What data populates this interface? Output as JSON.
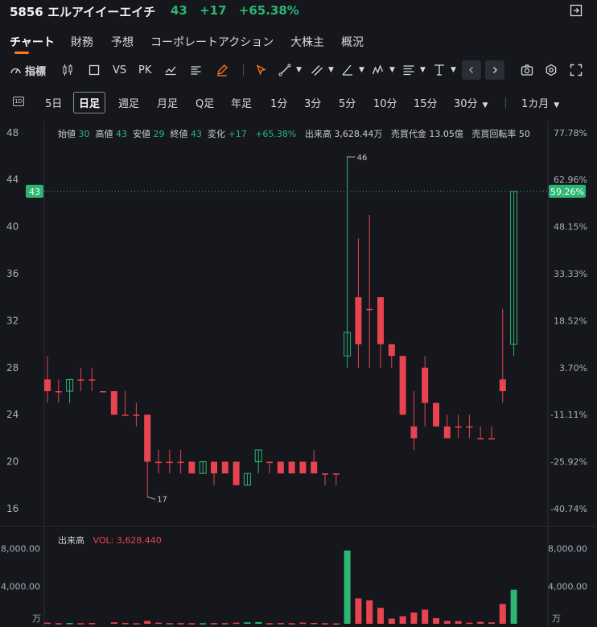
{
  "header": {
    "code_name": "5856 エルアイイーエイチ",
    "price": "43",
    "change": "+17",
    "change_pct": "+65.38%"
  },
  "tabs": [
    {
      "label": "チャート",
      "active": true
    },
    {
      "label": "財務"
    },
    {
      "label": "予想"
    },
    {
      "label": "コーポレートアクション"
    },
    {
      "label": "大株主"
    },
    {
      "label": "概況"
    }
  ],
  "toolbar": {
    "indicator_label": "指標",
    "vs_label": "VS",
    "pk_label": "PK"
  },
  "periods": {
    "icon_label": "1D",
    "items": [
      "5日",
      "日足",
      "週足",
      "月足",
      "Q足",
      "年足",
      "1分",
      "3分",
      "5分",
      "10分",
      "15分",
      "30分"
    ],
    "active": "日足",
    "range_label": "1カ月"
  },
  "ohlc": {
    "open_label": "始値",
    "open": "30",
    "high_label": "高値",
    "high": "43",
    "low_label": "安値",
    "low": "29",
    "close_label": "終値",
    "close": "43",
    "change_label": "変化",
    "change": "+17",
    "change_pct": "+65.38%",
    "volume_label": "出来高",
    "volume": "3,628.44万",
    "turnover_label": "売買代金",
    "turnover": "13.05億",
    "turnover_rate_label": "売買回転率",
    "turnover_rate": "50"
  },
  "volume_legend": {
    "title": "出来高",
    "vol_label": "VOL: 3,628.440"
  },
  "colors": {
    "up": "#2bb673",
    "down": "#e8444f",
    "accent": "#ff7a1a",
    "background": "#15171c"
  },
  "chart_data": {
    "type": "candlestick",
    "y_ticks": [
      48,
      44,
      40,
      36,
      32,
      28,
      24,
      20,
      16
    ],
    "y_pct_ticks": [
      "77.78%",
      "62.96%",
      "48.15%",
      "33.33%",
      "18.52%",
      "3.70%",
      "-11.11%",
      "-25.92%",
      "-40.74%"
    ],
    "ylim": [
      15,
      49
    ],
    "base_price": 27,
    "last_price": 43,
    "last_price_label": "43",
    "last_pct_label": "59.26%",
    "max_label": "46",
    "min_label": "17",
    "volume_ticks": [
      "8,000.00",
      "4,000.00"
    ],
    "volume_unit": "万",
    "volume_max": 9000,
    "candles": [
      {
        "o": 27,
        "h": 29,
        "l": 25,
        "c": 26,
        "v": 120
      },
      {
        "o": 26,
        "h": 27,
        "l": 25,
        "c": 26,
        "v": 60
      },
      {
        "o": 26,
        "h": 27,
        "l": 25,
        "c": 27,
        "v": 80
      },
      {
        "o": 27,
        "h": 28,
        "l": 26,
        "c": 27,
        "v": 60
      },
      {
        "o": 27,
        "h": 28,
        "l": 26,
        "c": 27,
        "v": 80
      },
      {
        "o": 26,
        "h": 26,
        "l": 26,
        "c": 26,
        "v": 0
      },
      {
        "o": 26,
        "h": 26,
        "l": 24,
        "c": 24,
        "v": 160
      },
      {
        "o": 24,
        "h": 26,
        "l": 24,
        "c": 24,
        "v": 90
      },
      {
        "o": 24,
        "h": 25,
        "l": 23,
        "c": 24,
        "v": 60
      },
      {
        "o": 24,
        "h": 24,
        "l": 17,
        "c": 20,
        "v": 300
      },
      {
        "o": 20,
        "h": 21,
        "l": 19,
        "c": 20,
        "v": 120
      },
      {
        "o": 20,
        "h": 21,
        "l": 19,
        "c": 20,
        "v": 70
      },
      {
        "o": 20,
        "h": 21,
        "l": 19,
        "c": 20,
        "v": 70
      },
      {
        "o": 20,
        "h": 20,
        "l": 19,
        "c": 19,
        "v": 60
      },
      {
        "o": 19,
        "h": 20,
        "l": 19,
        "c": 20,
        "v": 60
      },
      {
        "o": 20,
        "h": 20,
        "l": 18,
        "c": 19,
        "v": 70
      },
      {
        "o": 20,
        "h": 20,
        "l": 19,
        "c": 19,
        "v": 70
      },
      {
        "o": 20,
        "h": 20,
        "l": 18,
        "c": 18,
        "v": 120
      },
      {
        "o": 18,
        "h": 19,
        "l": 18,
        "c": 19,
        "v": 150
      },
      {
        "o": 20,
        "h": 21,
        "l": 19,
        "c": 21,
        "v": 180
      },
      {
        "o": 20,
        "h": 20,
        "l": 19,
        "c": 20,
        "v": 60
      },
      {
        "o": 20,
        "h": 20,
        "l": 19,
        "c": 19,
        "v": 80
      },
      {
        "o": 20,
        "h": 20,
        "l": 19,
        "c": 19,
        "v": 60
      },
      {
        "o": 20,
        "h": 20,
        "l": 19,
        "c": 19,
        "v": 120
      },
      {
        "o": 20,
        "h": 21,
        "l": 19,
        "c": 19,
        "v": 90
      },
      {
        "o": 19,
        "h": 19,
        "l": 18,
        "c": 19,
        "v": 60
      },
      {
        "o": 19,
        "h": 19,
        "l": 18,
        "c": 19,
        "v": 40
      },
      {
        "o": 29,
        "h": 46,
        "l": 28,
        "c": 31,
        "v": 7800
      },
      {
        "o": 34,
        "h": 39,
        "l": 28,
        "c": 30,
        "v": 2700
      },
      {
        "o": 33,
        "h": 41,
        "l": 28,
        "c": 33,
        "v": 2500
      },
      {
        "o": 34,
        "h": 34,
        "l": 28,
        "c": 30,
        "v": 1700
      },
      {
        "o": 30,
        "h": 30,
        "l": 28,
        "c": 29,
        "v": 550
      },
      {
        "o": 29,
        "h": 29,
        "l": 24,
        "c": 24,
        "v": 800
      },
      {
        "o": 23,
        "h": 26,
        "l": 21,
        "c": 22,
        "v": 1200
      },
      {
        "o": 28,
        "h": 29,
        "l": 23,
        "c": 25,
        "v": 1500
      },
      {
        "o": 25,
        "h": 25,
        "l": 23,
        "c": 23,
        "v": 600
      },
      {
        "o": 23,
        "h": 24,
        "l": 22,
        "c": 22,
        "v": 300
      },
      {
        "o": 23,
        "h": 24,
        "l": 22,
        "c": 23,
        "v": 280
      },
      {
        "o": 23,
        "h": 24,
        "l": 22,
        "c": 23,
        "v": 120
      },
      {
        "o": 22,
        "h": 23,
        "l": 22,
        "c": 22,
        "v": 200
      },
      {
        "o": 22,
        "h": 23,
        "l": 22,
        "c": 22,
        "v": 150
      },
      {
        "o": 27,
        "h": 33,
        "l": 25,
        "c": 26,
        "v": 2100
      },
      {
        "o": 30,
        "h": 43,
        "l": 29,
        "c": 43,
        "v": 3628
      }
    ]
  }
}
